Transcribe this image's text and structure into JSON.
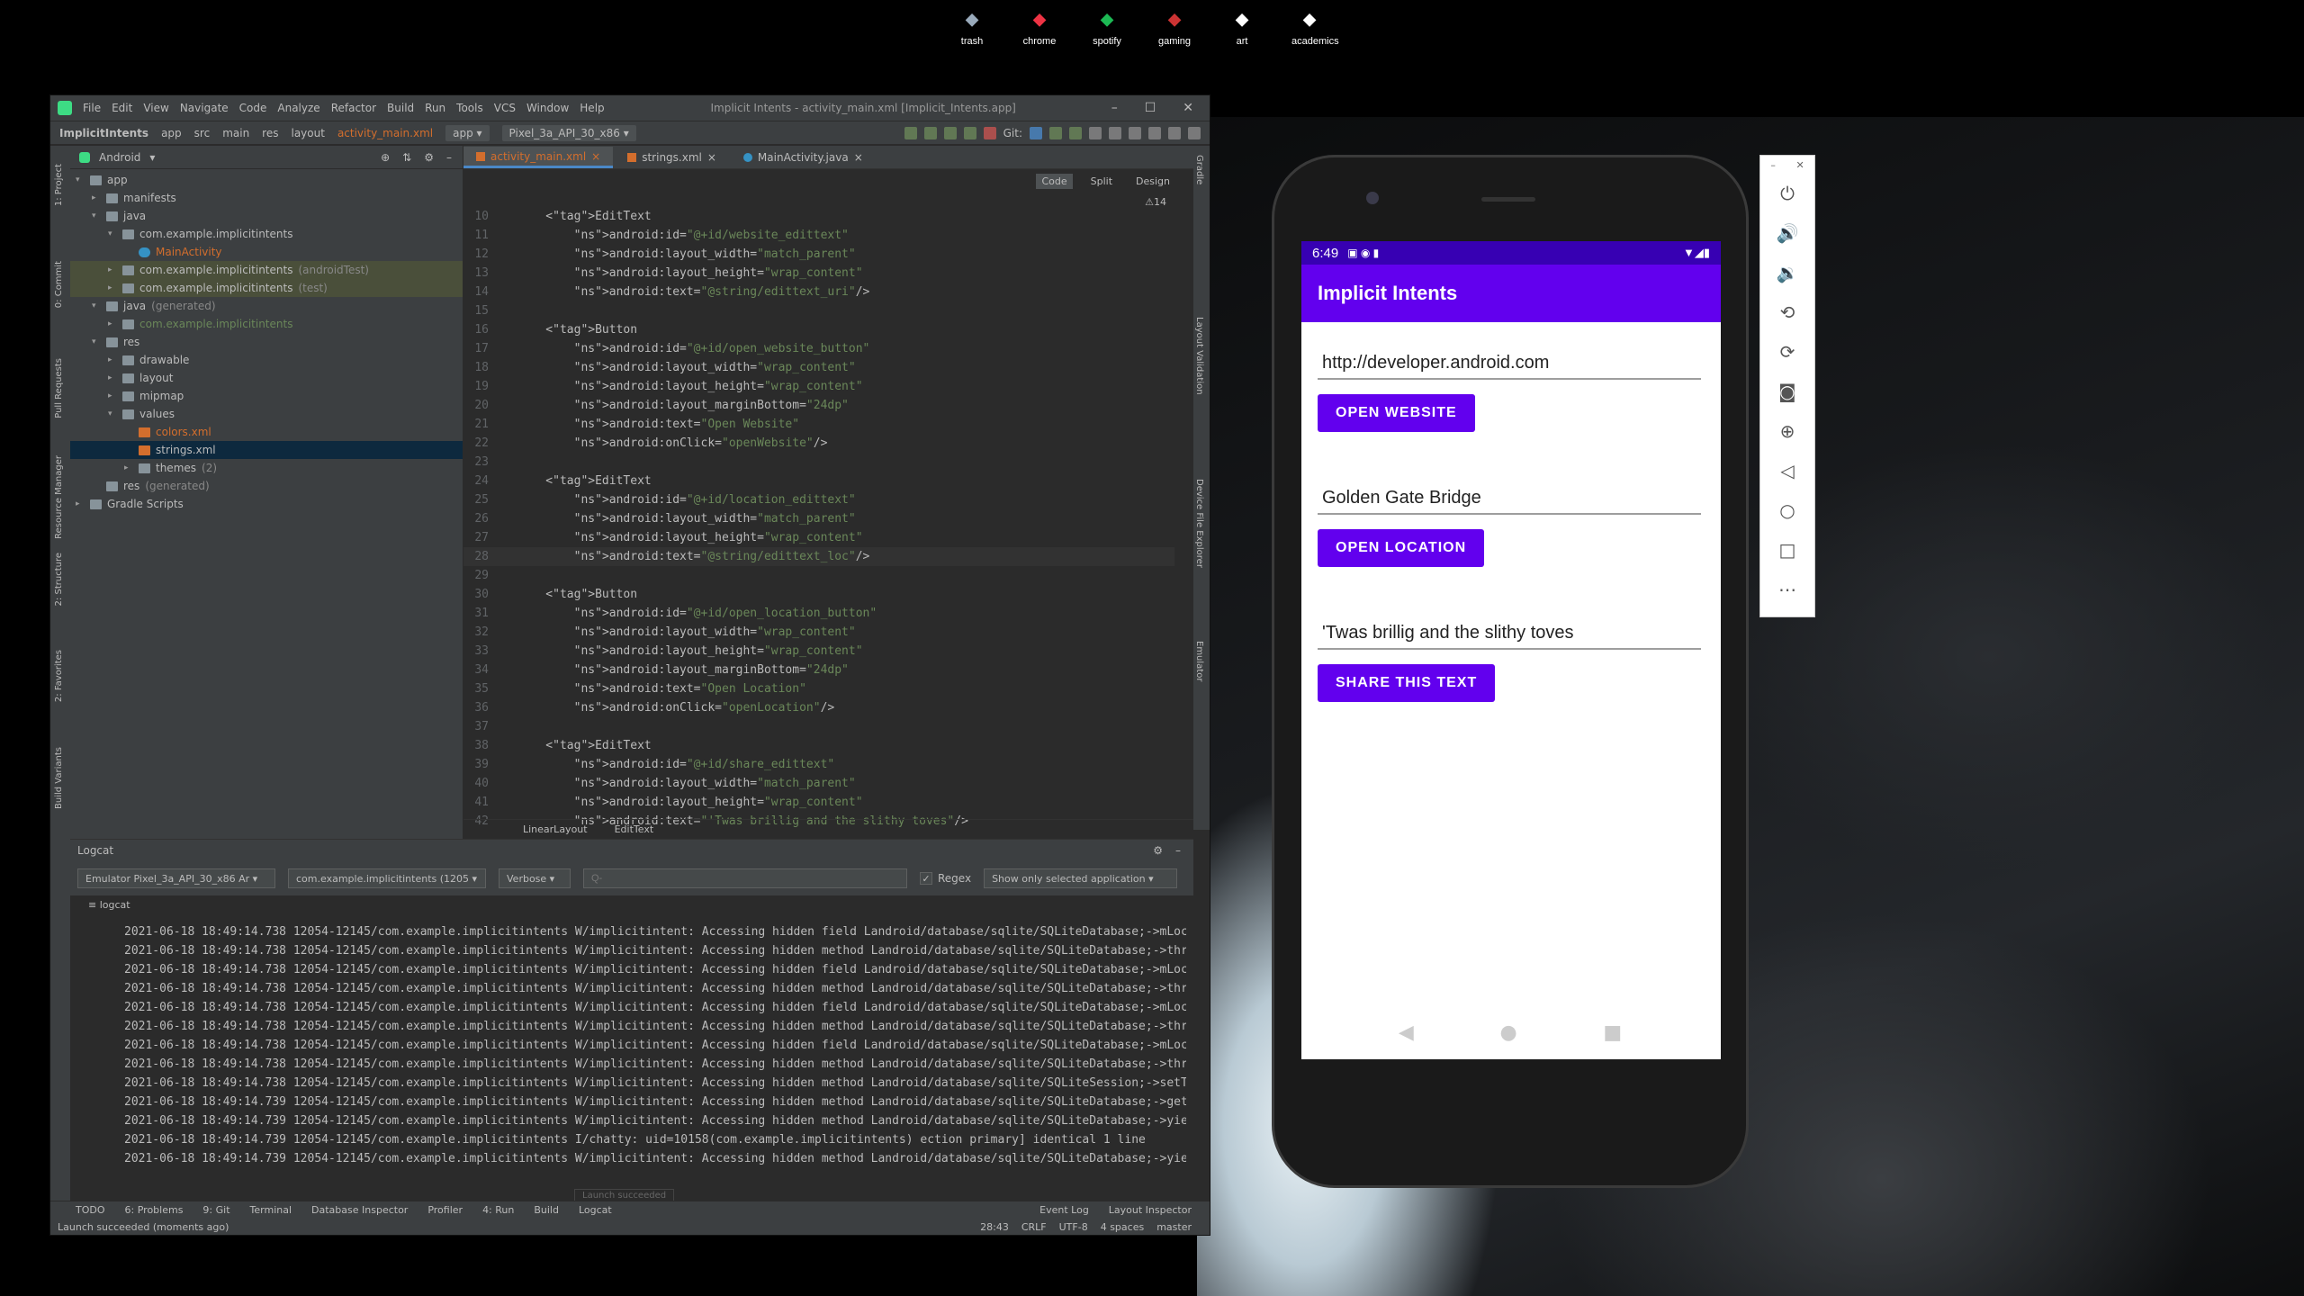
{
  "desktop": {
    "icons": [
      {
        "label": "trash",
        "color": "#9ab"
      },
      {
        "label": "chrome",
        "color": "#e34"
      },
      {
        "label": "spotify",
        "color": "#1db954"
      },
      {
        "label": "gaming",
        "color": "#c33"
      },
      {
        "label": "art",
        "color": "#fff"
      },
      {
        "label": "academics",
        "color": "#fff"
      }
    ]
  },
  "ide": {
    "menu": [
      "File",
      "Edit",
      "View",
      "Navigate",
      "Code",
      "Analyze",
      "Refactor",
      "Build",
      "Run",
      "Tools",
      "VCS",
      "Window",
      "Help"
    ],
    "window_title": "Implicit Intents - activity_main.xml [Implicit_Intents.app]",
    "breadcrumb": [
      "ImplicitIntents",
      "app",
      "src",
      "main",
      "res",
      "layout",
      "activity_main.xml"
    ],
    "run_config": "app",
    "device": "Pixel_3a_API_30_x86",
    "git_label": "Git:",
    "left_tools": [
      "1: Project",
      "0: Commit",
      "Pull Requests",
      "Resource Manager",
      "2: Structure",
      "2: Favorites",
      "Build Variants"
    ],
    "right_tools": [
      "Gradle",
      "Layout Validation",
      "Device File Explorer",
      "Emulator"
    ],
    "project_view": "Android",
    "tree": [
      {
        "label": "app",
        "level": 0,
        "arrow": "▾",
        "icon": "folder",
        "style": ""
      },
      {
        "label": "manifests",
        "level": 1,
        "arrow": "▸",
        "icon": "folder",
        "style": ""
      },
      {
        "label": "java",
        "level": 1,
        "arrow": "▾",
        "icon": "folder",
        "style": ""
      },
      {
        "label": "com.example.implicitintents",
        "level": 2,
        "arrow": "▾",
        "icon": "folder",
        "style": ""
      },
      {
        "label": "MainActivity",
        "level": 3,
        "arrow": "",
        "icon": "kotlin",
        "style": "red"
      },
      {
        "label": "com.example.implicitintents",
        "suffix": " (androidTest)",
        "level": 2,
        "arrow": "▸",
        "icon": "folder",
        "style": "hl"
      },
      {
        "label": "com.example.implicitintents",
        "suffix": " (test)",
        "level": 2,
        "arrow": "▸",
        "icon": "folder",
        "style": "hl"
      },
      {
        "label": "java",
        "suffix": " (generated)",
        "level": 1,
        "arrow": "▾",
        "icon": "folder",
        "style": ""
      },
      {
        "label": "com.example.implicitintents",
        "level": 2,
        "arrow": "▸",
        "icon": "folder",
        "style": "green"
      },
      {
        "label": "res",
        "level": 1,
        "arrow": "▾",
        "icon": "folder",
        "style": ""
      },
      {
        "label": "drawable",
        "level": 2,
        "arrow": "▸",
        "icon": "folder",
        "style": ""
      },
      {
        "label": "layout",
        "level": 2,
        "arrow": "▸",
        "icon": "folder",
        "style": ""
      },
      {
        "label": "mipmap",
        "level": 2,
        "arrow": "▸",
        "icon": "folder",
        "style": ""
      },
      {
        "label": "values",
        "level": 2,
        "arrow": "▾",
        "icon": "folder",
        "style": ""
      },
      {
        "label": "colors.xml",
        "level": 3,
        "arrow": "",
        "icon": "xml",
        "style": "red"
      },
      {
        "label": "strings.xml",
        "level": 3,
        "arrow": "",
        "icon": "xml",
        "style": "sel"
      },
      {
        "label": "themes",
        "suffix": " (2)",
        "level": 3,
        "arrow": "▸",
        "icon": "folder",
        "style": ""
      },
      {
        "label": "res",
        "suffix": " (generated)",
        "level": 1,
        "arrow": "",
        "icon": "folder",
        "style": ""
      },
      {
        "label": "Gradle Scripts",
        "level": 0,
        "arrow": "▸",
        "icon": "folder",
        "style": ""
      }
    ],
    "tabs": [
      {
        "label": "activity_main.xml",
        "active": true
      },
      {
        "label": "strings.xml",
        "active": false
      },
      {
        "label": "MainActivity.java",
        "active": false
      }
    ],
    "view_modes": [
      "Code",
      "Split",
      "Design"
    ],
    "warnings": "⚠14",
    "code": [
      {
        "n": "10",
        "t": "    <EditText"
      },
      {
        "n": "11",
        "t": "        android:id=\"@+id/website_edittext\""
      },
      {
        "n": "12",
        "t": "        android:layout_width=\"match_parent\""
      },
      {
        "n": "13",
        "t": "        android:layout_height=\"wrap_content\""
      },
      {
        "n": "14",
        "t": "        android:text=\"@string/edittext_uri\"/>"
      },
      {
        "n": "15",
        "t": ""
      },
      {
        "n": "16",
        "t": "    <Button"
      },
      {
        "n": "17",
        "t": "        android:id=\"@+id/open_website_button\""
      },
      {
        "n": "18",
        "t": "        android:layout_width=\"wrap_content\""
      },
      {
        "n": "19",
        "t": "        android:layout_height=\"wrap_content\""
      },
      {
        "n": "20",
        "t": "        android:layout_marginBottom=\"24dp\""
      },
      {
        "n": "21",
        "t": "        android:text=\"Open Website\""
      },
      {
        "n": "22",
        "t": "        android:onClick=\"openWebsite\"/>"
      },
      {
        "n": "23",
        "t": ""
      },
      {
        "n": "24",
        "t": "    <EditText"
      },
      {
        "n": "25",
        "t": "        android:id=\"@+id/location_edittext\""
      },
      {
        "n": "26",
        "t": "        android:layout_width=\"match_parent\""
      },
      {
        "n": "27",
        "t": "        android:layout_height=\"wrap_content\""
      },
      {
        "n": "28",
        "t": "        android:text=\"@string/edittext_loc\"/>"
      },
      {
        "n": "29",
        "t": ""
      },
      {
        "n": "30",
        "t": "    <Button"
      },
      {
        "n": "31",
        "t": "        android:id=\"@+id/open_location_button\""
      },
      {
        "n": "32",
        "t": "        android:layout_width=\"wrap_content\""
      },
      {
        "n": "33",
        "t": "        android:layout_height=\"wrap_content\""
      },
      {
        "n": "34",
        "t": "        android:layout_marginBottom=\"24dp\""
      },
      {
        "n": "35",
        "t": "        android:text=\"Open Location\""
      },
      {
        "n": "36",
        "t": "        android:onClick=\"openLocation\"/>"
      },
      {
        "n": "37",
        "t": ""
      },
      {
        "n": "38",
        "t": "    <EditText"
      },
      {
        "n": "39",
        "t": "        android:id=\"@+id/share_edittext\""
      },
      {
        "n": "40",
        "t": "        android:layout_width=\"match_parent\""
      },
      {
        "n": "41",
        "t": "        android:layout_height=\"wrap_content\""
      },
      {
        "n": "42",
        "t": "        android:text=\"'Twas brillig and the slithy toves\"/>"
      }
    ],
    "editor_crumbs": [
      "LinearLayout",
      "EditText"
    ],
    "logcat": {
      "title": "Logcat",
      "device": "Emulator Pixel_3a_API_30_x86 Ar",
      "package": "com.example.implicitintents (1205",
      "level": "Verbose",
      "search_placeholder": "Q-",
      "regex": "Regex",
      "filter": "Show only selected application",
      "tab": "logcat",
      "lines": [
        "2021-06-18 18:49:14.738 12054-12145/com.example.implicitintents W/implicitintent: Accessing hidden field Landroid/database/sqlite/SQLiteDatabase;->mLoc",
        "2021-06-18 18:49:14.738 12054-12145/com.example.implicitintents W/implicitintent: Accessing hidden method Landroid/database/sqlite/SQLiteDatabase;->thr",
        "2021-06-18 18:49:14.738 12054-12145/com.example.implicitintents W/implicitintent: Accessing hidden field Landroid/database/sqlite/SQLiteDatabase;->mLoc",
        "2021-06-18 18:49:14.738 12054-12145/com.example.implicitintents W/implicitintent: Accessing hidden method Landroid/database/sqlite/SQLiteDatabase;->thr",
        "2021-06-18 18:49:14.738 12054-12145/com.example.implicitintents W/implicitintent: Accessing hidden field Landroid/database/sqlite/SQLiteDatabase;->mLoc",
        "2021-06-18 18:49:14.738 12054-12145/com.example.implicitintents W/implicitintent: Accessing hidden method Landroid/database/sqlite/SQLiteDatabase;->thr",
        "2021-06-18 18:49:14.738 12054-12145/com.example.implicitintents W/implicitintent: Accessing hidden field Landroid/database/sqlite/SQLiteDatabase;->mLoc",
        "2021-06-18 18:49:14.738 12054-12145/com.example.implicitintents W/implicitintent: Accessing hidden method Landroid/database/sqlite/SQLiteDatabase;->thr",
        "2021-06-18 18:49:14.738 12054-12145/com.example.implicitintents W/implicitintent: Accessing hidden method Landroid/database/sqlite/SQLiteSession;->setT",
        "2021-06-18 18:49:14.739 12054-12145/com.example.implicitintents W/implicitintent: Accessing hidden method Landroid/database/sqlite/SQLiteDatabase;->get",
        "2021-06-18 18:49:14.739 12054-12145/com.example.implicitintents W/implicitintent: Accessing hidden method Landroid/database/sqlite/SQLiteDatabase;->yie",
        "2021-06-18 18:49:14.739 12054-12145/com.example.implicitintents I/chatty: uid=10158(com.example.implicitintents) ection primary] identical 1 line",
        "2021-06-18 18:49:14.739 12054-12145/com.example.implicitintents W/implicitintent: Accessing hidden method Landroid/database/sqlite/SQLiteDatabase;->yie"
      ],
      "toast": "Launch succeeded"
    },
    "bottom_tabs": [
      "TODO",
      "6: Problems",
      "9: Git",
      "Terminal",
      "Database Inspector",
      "Profiler",
      "4: Run",
      "Build",
      "Logcat"
    ],
    "bottom_right": [
      "Event Log",
      "Layout Inspector"
    ],
    "status_msg": "Launch succeeded (moments ago)",
    "status_right": [
      "28:43",
      "CRLF",
      "UTF-8",
      "4 spaces",
      "master"
    ]
  },
  "phone": {
    "time": "6:49",
    "app_title": "Implicit Intents",
    "website_text": "http://developer.android.com",
    "website_button": "OPEN WEBSITE",
    "location_text": "Golden Gate Bridge",
    "location_button": "OPEN LOCATION",
    "share_text": "'Twas brillig and the slithy toves",
    "share_button": "SHARE THIS TEXT",
    "colors": {
      "primary": "#6200ee",
      "status": "#3700b3"
    }
  }
}
